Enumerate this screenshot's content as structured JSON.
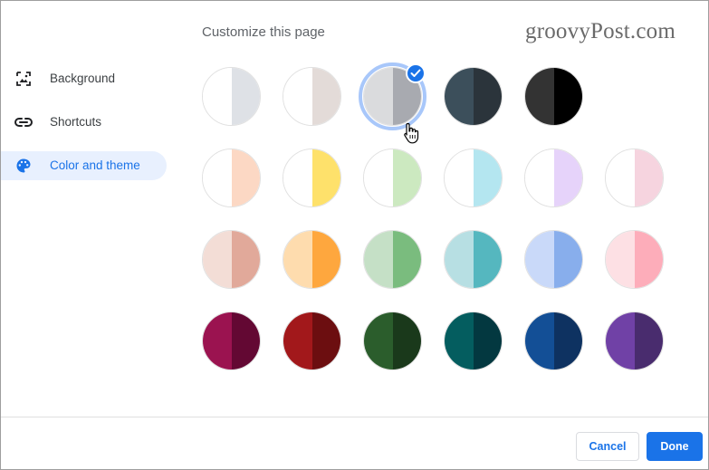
{
  "header": {
    "title": "Customize this page"
  },
  "watermark": {
    "text": "groovyPost.com"
  },
  "sidebar": {
    "items": [
      {
        "label": "Background",
        "icon": "image-icon",
        "active": false
      },
      {
        "label": "Shortcuts",
        "icon": "link-icon",
        "active": false
      },
      {
        "label": "Color and theme",
        "icon": "palette-icon",
        "active": true
      }
    ]
  },
  "themes": {
    "selected": "2",
    "rows": [
      [
        {
          "left": "#ffffff",
          "right": "#dee1e6"
        },
        {
          "left": "#ffffff",
          "right": "#e3dbd8"
        },
        {
          "left": "#dadbdd",
          "right": "#a8aab0"
        },
        {
          "left": "#3c4f5b",
          "right": "#2b343b"
        },
        {
          "left": "#333333",
          "right": "#000000"
        }
      ],
      [
        {
          "left": "#ffffff",
          "right": "#fcd8c4"
        },
        {
          "left": "#ffffff",
          "right": "#fee16b"
        },
        {
          "left": "#ffffff",
          "right": "#cce9c0"
        },
        {
          "left": "#ffffff",
          "right": "#b4e6f0"
        },
        {
          "left": "#ffffff",
          "right": "#e6d3fa"
        },
        {
          "left": "#ffffff",
          "right": "#f6d4df"
        }
      ],
      [
        {
          "left": "#f3ddd6",
          "right": "#e1a99a"
        },
        {
          "left": "#fedcae",
          "right": "#fea73e"
        },
        {
          "left": "#c5e0c6",
          "right": "#7abc7e"
        },
        {
          "left": "#b7dfe3",
          "right": "#55b7bf"
        },
        {
          "left": "#c9d9f9",
          "right": "#88aeec"
        },
        {
          "left": "#fde0e4",
          "right": "#fdadba"
        }
      ],
      [
        {
          "left": "#9b1350",
          "right": "#630833"
        },
        {
          "left": "#a2181b",
          "right": "#6c0e10"
        },
        {
          "left": "#2b5d2c",
          "right": "#1a391b"
        },
        {
          "left": "#045d5f",
          "right": "#033840"
        },
        {
          "left": "#134f96",
          "right": "#0e3261"
        },
        {
          "left": "#7041a6",
          "right": "#492c6e"
        }
      ]
    ]
  },
  "footer": {
    "cancel_label": "Cancel",
    "done_label": "Done"
  },
  "colors": {
    "accent": "#1a73e8",
    "active_bg": "#e8f0fe"
  }
}
